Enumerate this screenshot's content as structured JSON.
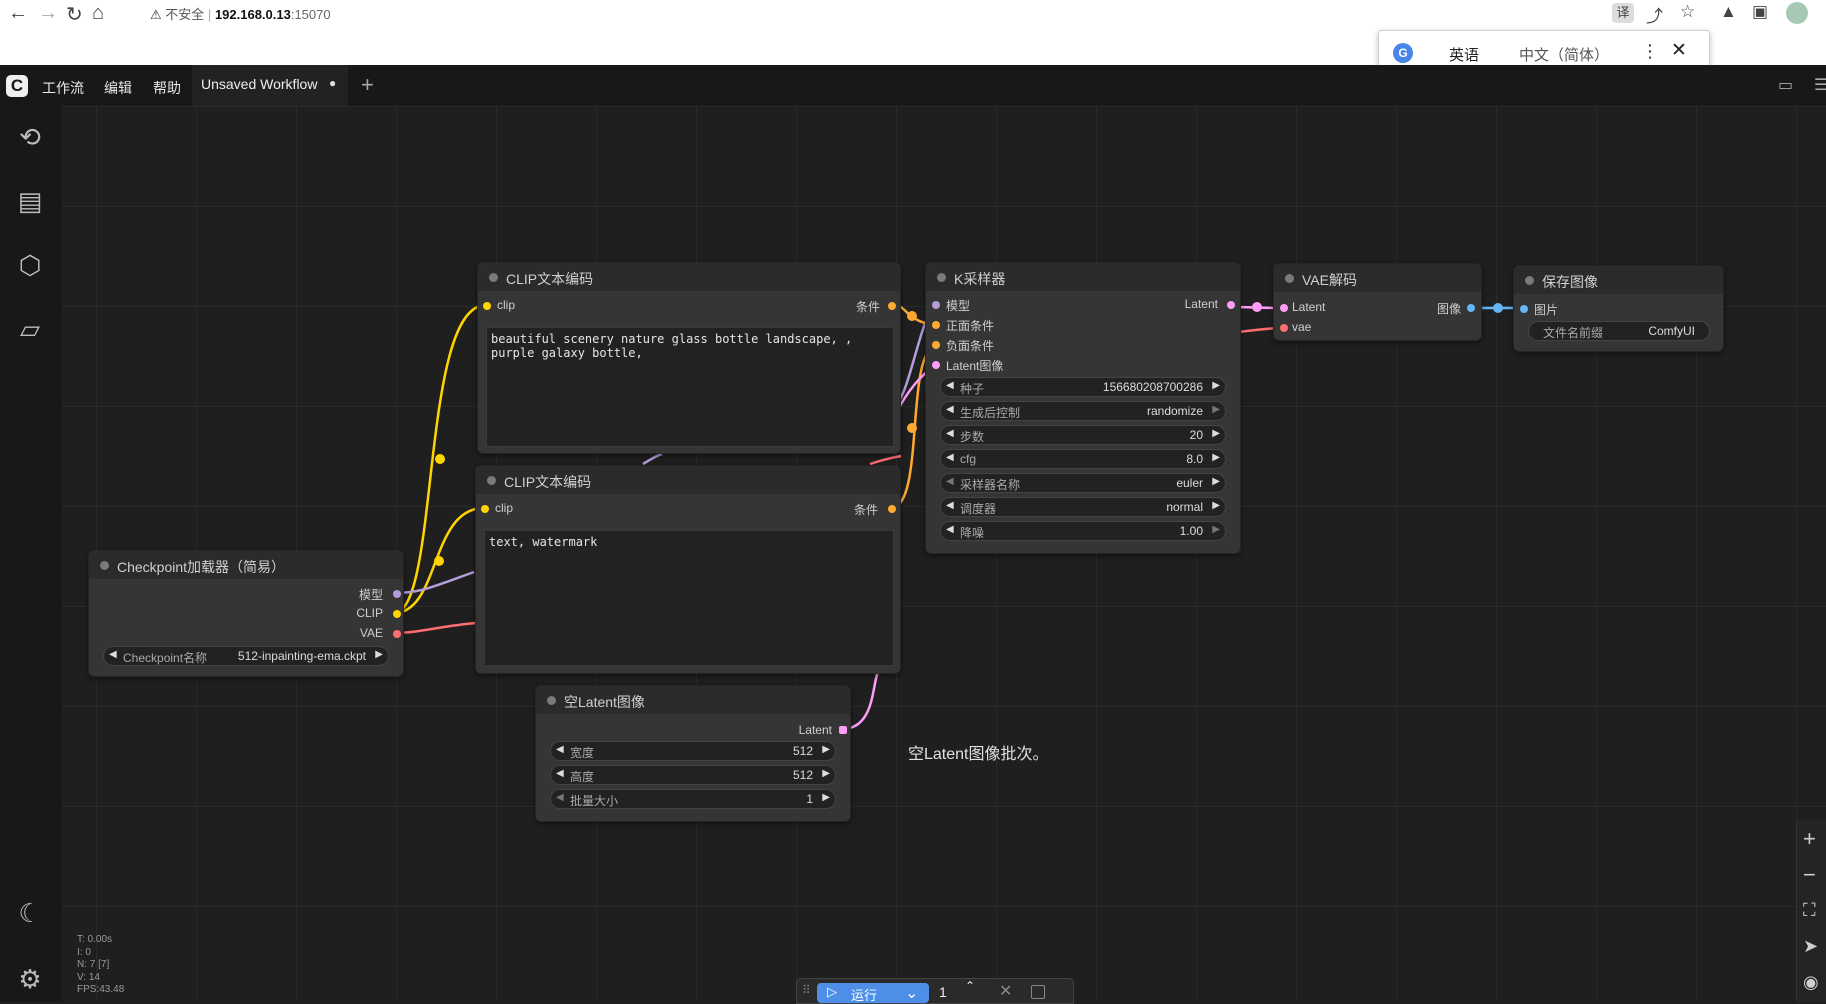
{
  "browser": {
    "not_secure": "不安全",
    "host": "192.168.0.13",
    "port": ":15070"
  },
  "translate_popup": {
    "source_lang": "英语",
    "target_lang": "中文（简体）"
  },
  "menubar": {
    "items": [
      "工作流",
      "编辑",
      "帮助"
    ],
    "tab_title": "Unsaved Workflow",
    "tab_dot": "●"
  },
  "sidebar": {
    "icons": [
      "history-icon",
      "queue-icon",
      "model-library-icon",
      "workflows-icon",
      "theme-toggle-icon",
      "settings-icon"
    ]
  },
  "nodes": {
    "clip_pos": {
      "title": "CLIP文本编码",
      "input": "clip",
      "output": "条件",
      "text": "beautiful scenery nature glass bottle landscape, ,\npurple galaxy bottle,"
    },
    "clip_neg": {
      "title": "CLIP文本编码",
      "input": "clip",
      "output": "条件",
      "text": "text, watermark"
    },
    "checkpoint": {
      "title": "Checkpoint加载器（简易）",
      "outputs": [
        "模型",
        "CLIP",
        "VAE"
      ],
      "widget_label": "Checkpoint名称",
      "widget_value": "512-inpainting-ema.ckpt"
    },
    "ksampler": {
      "title": "K采样器",
      "inputs": [
        "模型",
        "正面条件",
        "负面条件",
        "Latent图像"
      ],
      "output": "Latent",
      "widgets": [
        {
          "label": "种子",
          "value": "156680208700286"
        },
        {
          "label": "生成后控制",
          "value": "randomize"
        },
        {
          "label": "步数",
          "value": "20"
        },
        {
          "label": "cfg",
          "value": "8.0"
        },
        {
          "label": "采样器名称",
          "value": "euler"
        },
        {
          "label": "调度器",
          "value": "normal"
        },
        {
          "label": "降噪",
          "value": "1.00"
        }
      ]
    },
    "vae_decode": {
      "title": "VAE解码",
      "inputs": [
        "Latent",
        "vae"
      ],
      "output": "图像"
    },
    "save_image": {
      "title": "保存图像",
      "input": "图片",
      "widget_label": "文件名前缀",
      "widget_value": "ComfyUI"
    },
    "empty_latent": {
      "title": "空Latent图像",
      "output": "Latent",
      "widgets": [
        {
          "label": "宽度",
          "value": "512"
        },
        {
          "label": "高度",
          "value": "512"
        },
        {
          "label": "批量大小",
          "value": "1"
        }
      ]
    }
  },
  "tooltip": "空Latent图像批次。",
  "stats": [
    "T: 0.00s",
    "I: 0",
    "N: 7 [7]",
    "V: 14",
    "FPS:43.48"
  ],
  "runbar": {
    "run_label": "运行",
    "count": "1"
  },
  "colors": {
    "clip_link": "#ffd500",
    "model_link": "#b39ddb",
    "vae_link": "#ff6e6e",
    "conditioning_link": "#ffa931",
    "latent_link": "#ff9cf9",
    "image_link": "#64b5f6",
    "accent": "#4d8fe8"
  }
}
